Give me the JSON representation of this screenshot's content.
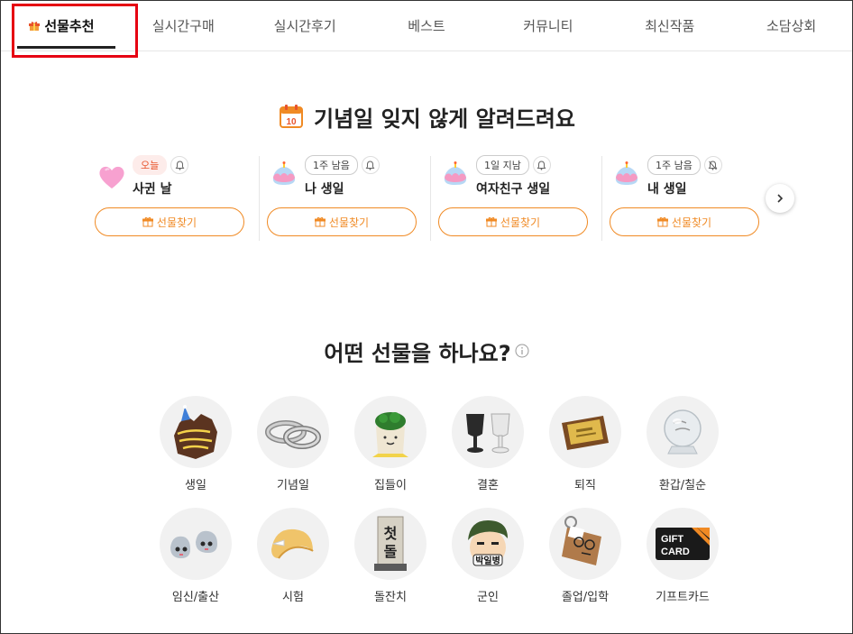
{
  "nav": {
    "tabs": [
      {
        "label": "선물추천",
        "active": true
      },
      {
        "label": "실시간구매",
        "active": false
      },
      {
        "label": "실시간후기",
        "active": false
      },
      {
        "label": "베스트",
        "active": false
      },
      {
        "label": "커뮤니티",
        "active": false
      },
      {
        "label": "최신작품",
        "active": false
      },
      {
        "label": "소담상회",
        "active": false
      }
    ]
  },
  "anniversary": {
    "title": "기념일 잊지 않게 알려드려요",
    "calendar_day": "10",
    "reminders": [
      {
        "tag": "오늘",
        "name": "사귄 날",
        "button": "선물찾기",
        "icon": "pink-heart-icon",
        "bell": "bell-icon"
      },
      {
        "tag": "1주 남음",
        "name": "나 생일",
        "button": "선물찾기",
        "icon": "birthday-cake-icon",
        "bell": "bell-icon"
      },
      {
        "tag": "1일 지남",
        "name": "여자친구 생일",
        "button": "선물찾기",
        "icon": "birthday-cake-icon",
        "bell": "bell-icon"
      },
      {
        "tag": "1주 남음",
        "name": "내 생일",
        "button": "선물찾기",
        "icon": "birthday-cake-icon",
        "bell": "bell-off-icon"
      }
    ]
  },
  "categories": {
    "title": "어떤 선물을 하나요?",
    "items": [
      {
        "label": "생일",
        "icon": "birthday-cookie-icon"
      },
      {
        "label": "기념일",
        "icon": "couple-rings-icon"
      },
      {
        "label": "집들이",
        "icon": "plant-pot-icon"
      },
      {
        "label": "결혼",
        "icon": "wedding-cups-icon"
      },
      {
        "label": "퇴직",
        "icon": "plaque-icon"
      },
      {
        "label": "환갑/칠순",
        "icon": "crystal-ball-icon"
      },
      {
        "label": "임신/출산",
        "icon": "baby-shoes-icon"
      },
      {
        "label": "시험",
        "icon": "fortune-cookie-icon"
      },
      {
        "label": "돌잔치",
        "icon": "dol-sign-icon"
      },
      {
        "label": "군인",
        "icon": "soldier-icon"
      },
      {
        "label": "졸업/입학",
        "icon": "graduation-keyring-icon"
      },
      {
        "label": "기프트카드",
        "icon": "gift-card-icon"
      }
    ],
    "soldier_text": "박일병",
    "dol_text": "첫돌",
    "giftcard_text_1": "GIFT",
    "giftcard_text_2": "CARD"
  },
  "colors": {
    "accent": "#f08a24",
    "highlight": "#e60012",
    "today_tag": "#e8532b"
  }
}
